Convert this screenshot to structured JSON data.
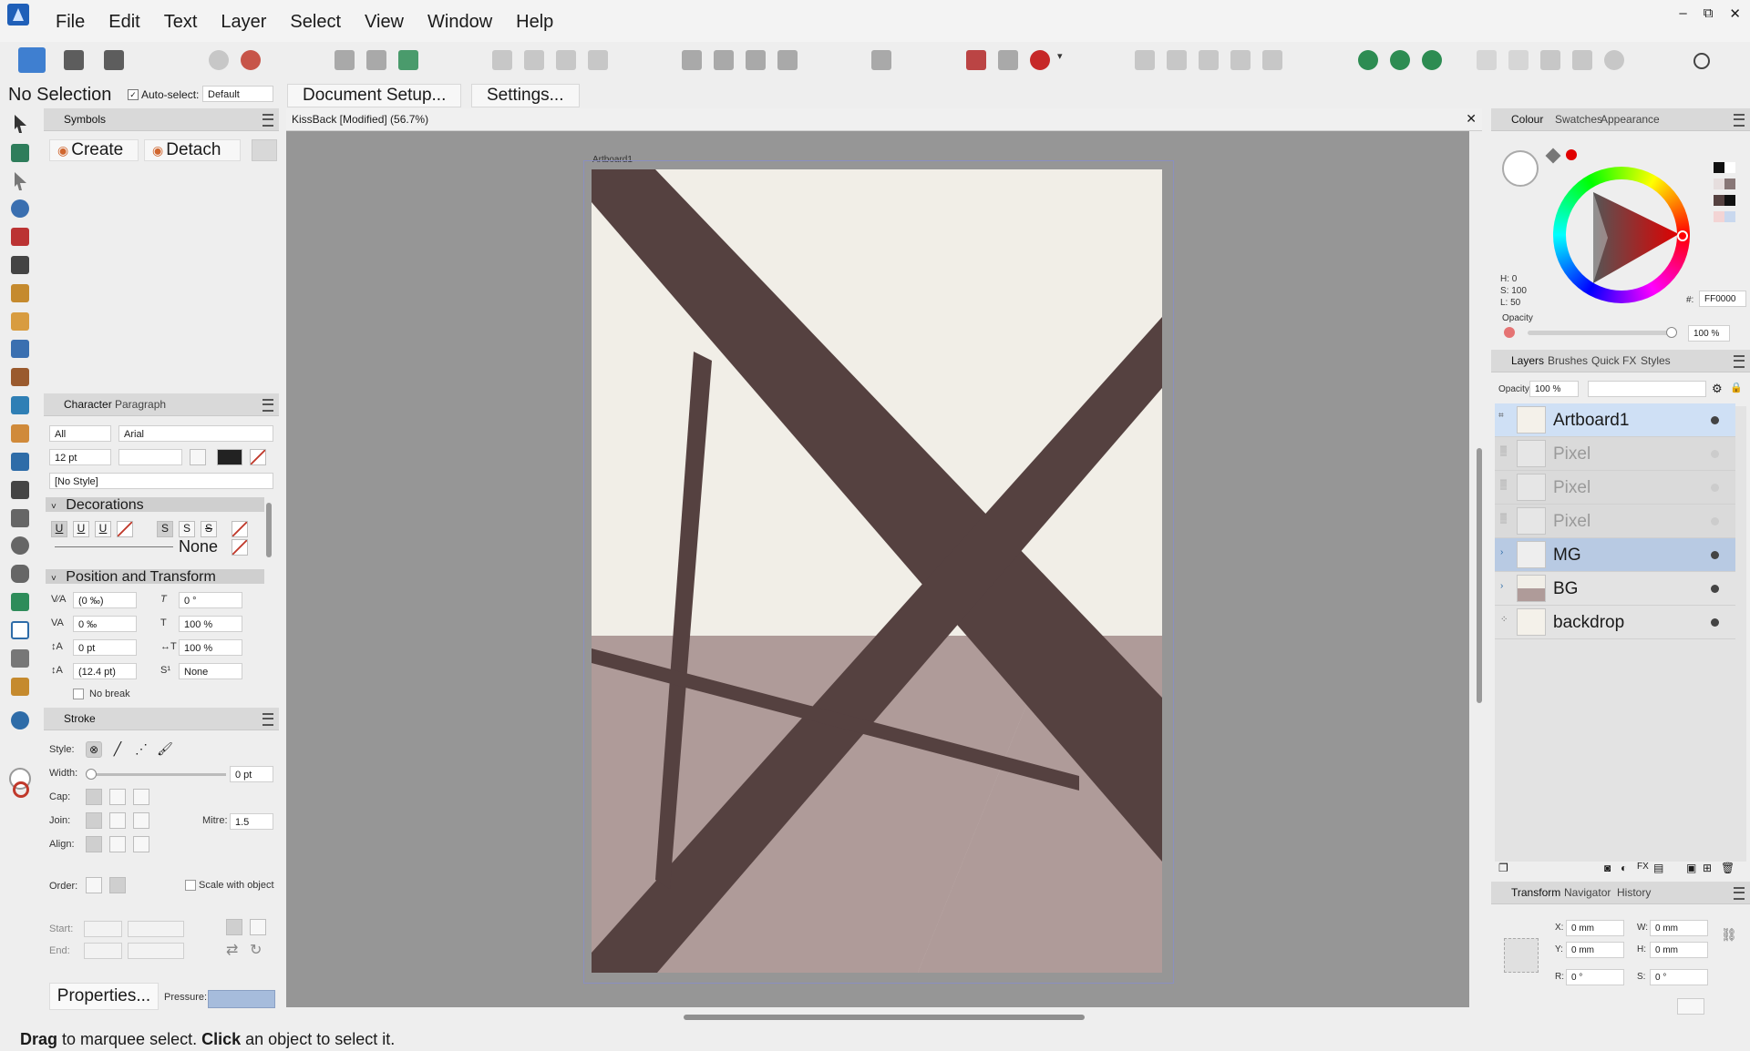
{
  "menu": [
    "File",
    "Edit",
    "Text",
    "Layer",
    "Select",
    "View",
    "Window",
    "Help"
  ],
  "window_controls": [
    "–",
    "⧉",
    "✕"
  ],
  "context": {
    "selection": "No Selection",
    "autoselect_label": "Auto-select:",
    "autoselect_value": "Default",
    "doc_setup": "Document Setup...",
    "settings": "Settings..."
  },
  "symbols": {
    "tab": "Symbols",
    "create": "Create",
    "detach": "Detach"
  },
  "character": {
    "tabs": [
      "Character",
      "Paragraph"
    ],
    "scope": "All",
    "font": "Arial",
    "size": "12 pt",
    "style": "[No Style]",
    "decorations": "Decorations",
    "none_label": "None",
    "position_transform": "Position and Transform",
    "kerning": "(0 ‰)",
    "tracking": "0 ‰",
    "baseline": "0 pt",
    "leading": "(12.4 pt)",
    "skew": "0 °",
    "vscale": "100 %",
    "hscale": "100 %",
    "typography": "None",
    "no_break": "No break"
  },
  "stroke": {
    "tab": "Stroke",
    "style_lbl": "Style:",
    "width_lbl": "Width:",
    "width_val": "0 pt",
    "cap_lbl": "Cap:",
    "join_lbl": "Join:",
    "mitre_lbl": "Mitre:",
    "mitre_val": "1.5",
    "align_lbl": "Align:",
    "order_lbl": "Order:",
    "scale_lbl": "Scale with object",
    "start_lbl": "Start:",
    "end_lbl": "End:",
    "properties": "Properties...",
    "pressure": "Pressure:"
  },
  "document": {
    "title": "KissBack [Modified] (56.7%)",
    "artboard_label": "Artboard1"
  },
  "colour": {
    "tabs": [
      "Colour",
      "Swatches",
      "Appearance"
    ],
    "h": "H: 0",
    "s": "S: 100",
    "l": "L: 50",
    "hex": "FF0000",
    "hex_prefix": "#:",
    "opacity_lbl": "Opacity",
    "opacity_val": "100 %",
    "accent": "#FF0000"
  },
  "layers_panel": {
    "tabs": [
      "Layers",
      "Brushes",
      "Quick FX",
      "Styles"
    ],
    "opacity_lbl": "Opacity:",
    "opacity_val": "100 %",
    "rows": [
      {
        "name": "Artboard1"
      },
      {
        "name": "Pixel"
      },
      {
        "name": "Pixel"
      },
      {
        "name": "Pixel"
      },
      {
        "name": "MG"
      },
      {
        "name": "BG"
      },
      {
        "name": "backdrop"
      }
    ]
  },
  "transform": {
    "tabs": [
      "Transform",
      "Navigator",
      "History"
    ],
    "x_lbl": "X:",
    "x": "0 mm",
    "y_lbl": "Y:",
    "y": "0 mm",
    "w_lbl": "W:",
    "w": "0 mm",
    "h_lbl": "H:",
    "h": "0 mm",
    "r_lbl": "R:",
    "r": "0 °",
    "s_lbl": "S:",
    "s": "0 °"
  },
  "status": {
    "drag": "Drag",
    "t1": " to marquee select. ",
    "click": "Click",
    "t2": " an object to select it."
  }
}
